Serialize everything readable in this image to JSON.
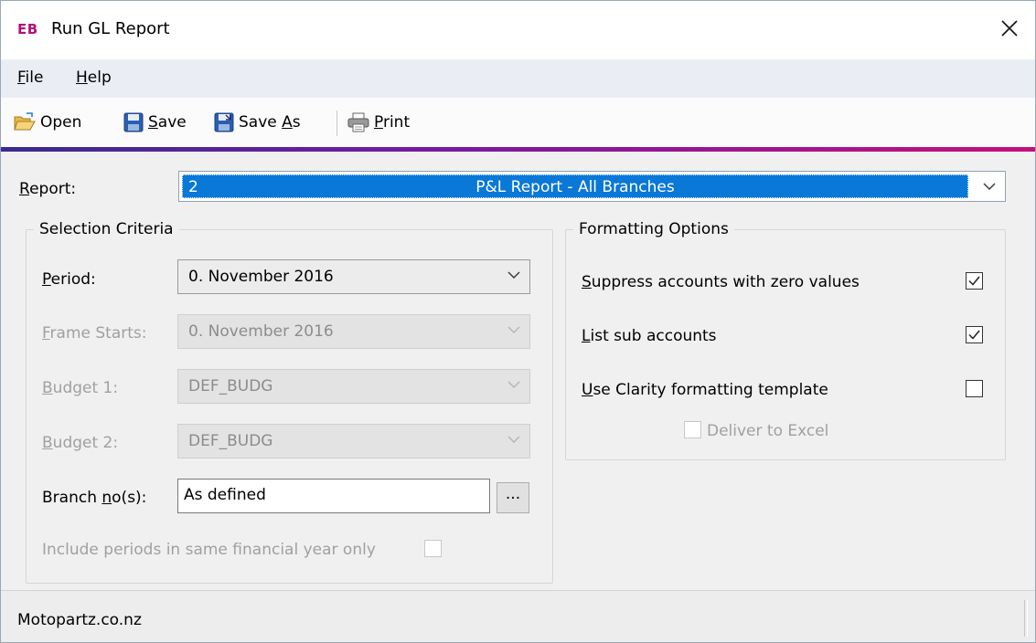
{
  "window": {
    "app_badge": "EB",
    "title": "Run GL Report"
  },
  "menu": {
    "file_key": "F",
    "file_rest": "ile",
    "help_key": "H",
    "help_rest": "elp"
  },
  "toolbar": {
    "open_label": "Open",
    "save_key": "S",
    "save_rest": "ave",
    "saveas_pre": "Save ",
    "saveas_key": "A",
    "saveas_rest": "s",
    "print_key": "P",
    "print_rest": "rint"
  },
  "report": {
    "label_key": "R",
    "label_rest": "eport:",
    "selected_number": "2",
    "selected_name": "P&L Report - All Branches"
  },
  "selection_criteria": {
    "title": "Selection Criteria",
    "period_key": "P",
    "period_rest": "eriod:",
    "period_value": "0. November 2016",
    "frame_key": "F",
    "frame_rest": "rame Starts:",
    "frame_value": "0. November 2016",
    "budget1_key": "B",
    "budget1_rest": "udget 1:",
    "budget1_value": "DEF_BUDG",
    "budget2_key": "B",
    "budget2_rest": "udget 2:",
    "budget2_value": "DEF_BUDG",
    "branch_pre": "Branch ",
    "branch_key": "n",
    "branch_rest": "o(s):",
    "branch_value": "As defined",
    "branch_button": "...",
    "include_label": "Include periods in same financial year only"
  },
  "formatting_options": {
    "title": "Formatting Options",
    "suppress_key": "S",
    "suppress_rest": "uppress accounts with zero values",
    "suppress_checked": true,
    "list_key": "L",
    "list_rest": "ist sub accounts",
    "list_checked": true,
    "clarity_key": "U",
    "clarity_rest": "se Clarity formatting template",
    "clarity_checked": false,
    "deliver_label": "Deliver to Excel",
    "deliver_checked": false
  },
  "status": {
    "text": "Motopartz.co.nz"
  },
  "colors": {
    "accent_start": "#3a2a90",
    "accent_end": "#c4107a",
    "selection_blue": "#0a78d7",
    "badge": "#b0127a"
  }
}
